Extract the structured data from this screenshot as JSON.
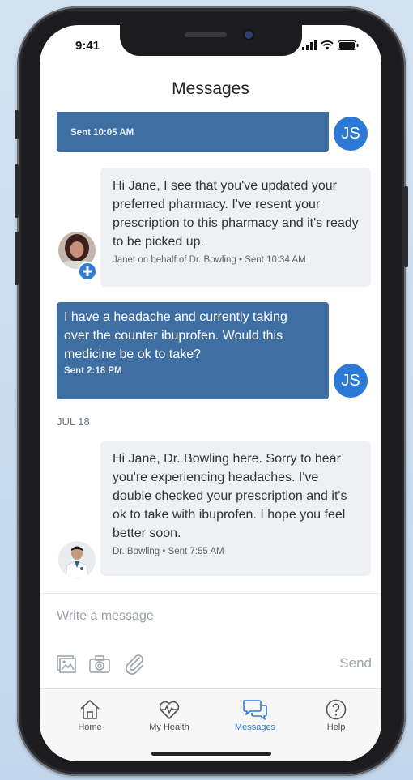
{
  "status_bar": {
    "time": "9:41"
  },
  "header": {
    "title": "Messages"
  },
  "messages": [
    {
      "direction": "out",
      "text": "",
      "meta": "Sent 10:05 AM",
      "initials": "JS"
    },
    {
      "direction": "in",
      "text": "Hi Jane, I see that you've updated your preferred pharmacy. I've resent your prescription to this pharmacy and it's ready to be picked up.",
      "meta": "Janet on behalf of Dr. Bowling • Sent 10:34 AM"
    },
    {
      "direction": "out",
      "text": "I have a headache and currently taking over the counter ibuprofen. Would this medicine be ok to take?",
      "meta": "Sent 2:18 PM",
      "initials": "JS"
    },
    {
      "direction": "in",
      "text": "Hi Jane, Dr. Bowling here. Sorry to hear you're experiencing headaches. I've double checked your prescription and it's ok to take with ibuprofen. I hope you feel better soon.",
      "meta": "Dr. Bowling • Sent 7:55 AM"
    }
  ],
  "date_separator": "JUL 18",
  "composer": {
    "placeholder": "Write a message",
    "send_label": "Send",
    "attachments": [
      "image-icon",
      "camera-icon",
      "paperclip-icon"
    ]
  },
  "tabs": [
    {
      "label": "Home",
      "icon": "home-icon",
      "active": false
    },
    {
      "label": "My Health",
      "icon": "heart-pulse-icon",
      "active": false
    },
    {
      "label": "Messages",
      "icon": "chat-bubbles-icon",
      "active": true
    },
    {
      "label": "Help",
      "icon": "question-icon",
      "active": false
    }
  ],
  "colors": {
    "accent": "#3f6ea3",
    "active_tab": "#2f78d4",
    "initials_bg": "#2c7ad6"
  }
}
